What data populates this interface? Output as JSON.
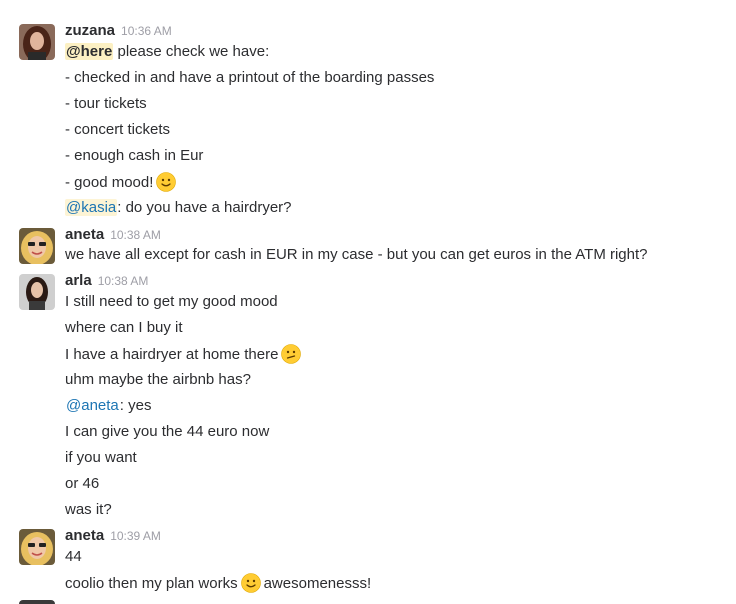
{
  "messages": [
    {
      "author": "zuzana",
      "time": "10:36 AM",
      "avatar": "zuzana-avatar",
      "lines": [
        {
          "mention": "@here",
          "text": " please check we have:"
        },
        {
          "text": "- checked in and have a printout of the boarding passes"
        },
        {
          "text": "- tour tickets"
        },
        {
          "text": "- concert tickets"
        },
        {
          "text": "- enough cash in Eur"
        },
        {
          "text": "- good mood!",
          "emoji": "slightly-smiling-face-icon"
        },
        {
          "mention": "@kasia",
          "text": ": do you have a hairdryer?"
        }
      ]
    },
    {
      "author": "aneta",
      "time": "10:38 AM",
      "avatar": "aneta-avatar",
      "lines": [
        {
          "text": "we have all except for cash in EUR in my case - but you can get euros in the ATM right?"
        }
      ]
    },
    {
      "author": "arla",
      "time": "10:38 AM",
      "avatar": "arla-avatar",
      "lines": [
        {
          "text": "I still need to get my good mood"
        },
        {
          "text": "where can I buy it"
        },
        {
          "text": "I have a hairdryer at home there",
          "emoji": "confused-face-icon"
        },
        {
          "text": "uhm maybe the airbnb has?"
        },
        {
          "mention": "@aneta",
          "text": ": yes"
        },
        {
          "text": "I can give you the 44 euro now"
        },
        {
          "text": "if you want"
        },
        {
          "text": "or 46"
        },
        {
          "text": "was it?"
        }
      ]
    },
    {
      "author": "aneta",
      "time": "10:39 AM",
      "avatar": "aneta-avatar",
      "lines": [
        {
          "text": "44"
        },
        {
          "text": "coolio then my plan works",
          "emoji": "slightly-smiling-face-icon",
          "after": "awesomenesss!"
        }
      ]
    }
  ],
  "colors": {
    "mention_blue": "#1d75b3",
    "here_highlight": "#fcf0c3",
    "timestamp": "#9e9ea6"
  }
}
